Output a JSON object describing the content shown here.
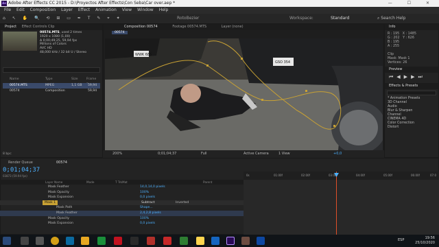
{
  "window": {
    "title": "Adobe After Effects CC 2015 - D:\\Proyectos After Effects\\Con Seba\\Car over.aep *"
  },
  "menu": [
    "File",
    "Edit",
    "Composition",
    "Layer",
    "Effect",
    "Animation",
    "View",
    "Window",
    "Help"
  ],
  "toolbar": {
    "rotobezier": "RotoBezier",
    "workspace_label": "Workspace:",
    "workspace_value": "Standard",
    "search_placeholder": "Search Help"
  },
  "project": {
    "tabs": [
      "Project",
      "Effect Controls Clip"
    ],
    "file_name": "00574.MTS",
    "file_used": ", used 2 times",
    "info_lines": [
      "1920 x 1080 (1,00)",
      "Δ 0;00;49;25, 59,94 fps",
      "Millions of Colors",
      "AVC HD",
      "48,000 kHz / 32 bit U / Stereo"
    ],
    "columns": {
      "name": "Name",
      "type": "Type",
      "size": "Size",
      "frame_rate": "Frame R..."
    },
    "items": [
      {
        "name": "00574.MTS",
        "type": "MPEG",
        "size": "1,1 GB",
        "fps": "59,94"
      },
      {
        "name": "00574",
        "type": "Composition",
        "size": "",
        "fps": "59,94"
      }
    ],
    "bpc": "8 bpc"
  },
  "composition": {
    "tabs": [
      "Composition 00574",
      "Footage 00574.MTS",
      "Layer (none)"
    ],
    "breadcrumb": "00574",
    "plate1": "WWK 685",
    "plate2": "GSO 354",
    "viewer_bar": {
      "zoom": "200%",
      "timecode": "0;01;04;37",
      "resolution": "Full",
      "camera": "Active Camera",
      "views": "1 View",
      "exposure": "+0,0"
    }
  },
  "info": {
    "title": "Info",
    "r": "R : 195",
    "g": "G : 202",
    "b": "B : 195",
    "a": "A : 255",
    "x": "X : 1485",
    "y": "Y : 626",
    "clip_label": "Clip",
    "mask_label": "Mask: Mask 1",
    "vertices": "Vertices: 26"
  },
  "preview": {
    "title": "Preview"
  },
  "effects": {
    "title": "Effects & Presets",
    "items": [
      "* Animation Presets",
      "3D Channel",
      "Audio",
      "Blur & Sharpen",
      "Channel",
      "CINEMA 4D",
      "Color Correction",
      "Distort"
    ]
  },
  "timeline": {
    "tabs": [
      "Render Queue",
      "00574"
    ],
    "timecode": "0;01;04;37",
    "frame_info": "03873 (59.94 fps)",
    "headers": {
      "layer_name": "Layer Name",
      "mode": "Mode",
      "trkmat": "T TrkMat",
      "parent": "Parent"
    },
    "rows": [
      {
        "name": "Mask Feather",
        "value": "14,0,14,0 pixels",
        "indent": 70
      },
      {
        "name": "Mask Opacity",
        "value": "100%",
        "indent": 70
      },
      {
        "name": "Mask Expansion",
        "value": "0,0 pixels",
        "indent": 70
      },
      {
        "name": "Mask 1",
        "value": "",
        "indent": 62,
        "mode": "Subtract",
        "inverted": "Inverted"
      },
      {
        "name": "Mask Path",
        "value": "Shape...",
        "indent": 82
      },
      {
        "name": "Mask Feather",
        "value": "2,4,2,8 pixels",
        "indent": 82
      },
      {
        "name": "Mask Opacity",
        "value": "100%",
        "indent": 70
      },
      {
        "name": "Mask Expansion",
        "value": "0,0 pixels",
        "indent": 70
      }
    ],
    "ruler": [
      "0s",
      "01:00f",
      "02:00f",
      "03:00f",
      "04:00f",
      "05:00f",
      "06:00f",
      "07:0"
    ]
  },
  "taskbar": {
    "time": "19:56",
    "date": "25/10/2020",
    "lang": "ESP"
  }
}
